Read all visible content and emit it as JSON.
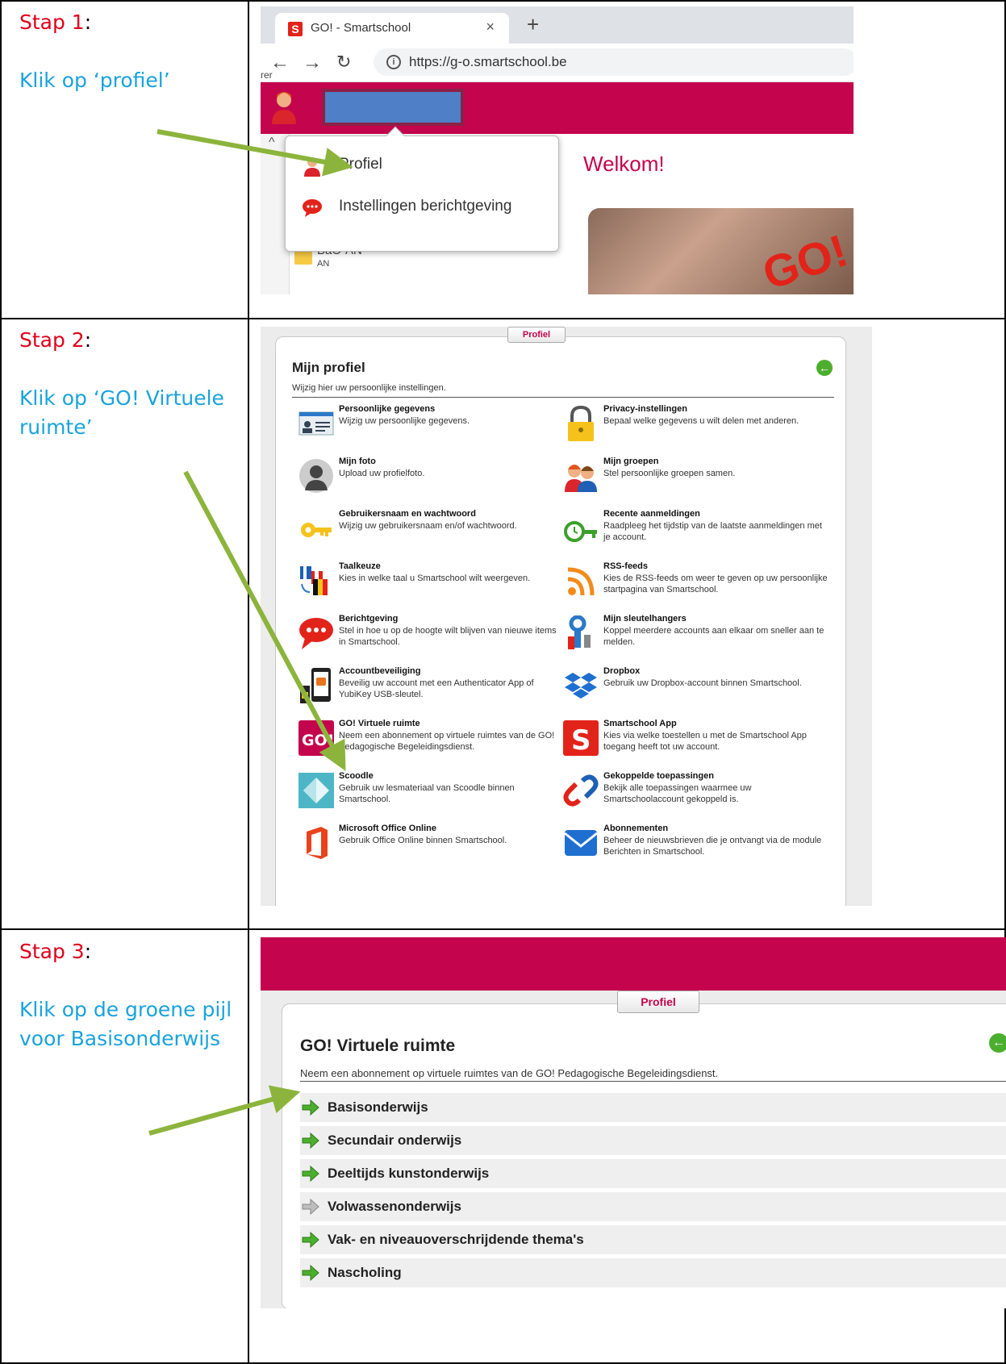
{
  "rows": [
    {
      "stap": "Stap 1",
      "colon": ":",
      "instruction": "Klik op ‘profiel’"
    },
    {
      "stap": "Stap 2",
      "colon": ":",
      "instruction": "Klik op ‘GO! Virtuele ruimte’"
    },
    {
      "stap": "Stap 3",
      "colon": ":",
      "instruction": "Klik op de groene pijl voor Basisonderwijs"
    }
  ],
  "step1": {
    "tab_title": "GO! - Smartschool",
    "tab_close": "×",
    "new_tab": "+",
    "url": "https://g-o.smartschool.be",
    "welcome": "Welkom!",
    "popup": [
      {
        "label": "Profiel",
        "icon": "user-icon"
      },
      {
        "label": "Instellingen berichtgeving",
        "icon": "chat-bubble-icon"
      }
    ],
    "sidebar_item": "BaO-AN",
    "sidebar_item_sub": "AN",
    "side_fragment": "rer",
    "logo_text": "GO!"
  },
  "step2": {
    "tab": "Profiel",
    "title": "Mijn profiel",
    "subtitle": "Wijzig hier uw persoonlijke instellingen.",
    "items_left": [
      {
        "title": "Persoonlijke gegevens",
        "desc": "Wijzig uw persoonlijke gegevens.",
        "icon": "id-card-icon"
      },
      {
        "title": "Mijn foto",
        "desc": "Upload uw profielfoto.",
        "icon": "avatar-icon"
      },
      {
        "title": "Gebruikersnaam en wachtwoord",
        "desc": "Wijzig uw gebruikersnaam en/of wachtwoord.",
        "icon": "key-icon"
      },
      {
        "title": "Taalkeuze",
        "desc": "Kies in welke taal u Smartschool wilt weergeven.",
        "icon": "flags-icon"
      },
      {
        "title": "Berichtgeving",
        "desc": "Stel in hoe u op de hoogte wilt blijven van nieuwe items in Smartschool.",
        "icon": "chat-bubble-icon"
      },
      {
        "title": "Accountbeveiliging",
        "desc": "Beveilig uw account met een Authenticator App of YubiKey USB-sleutel.",
        "icon": "phone-usb-icon"
      },
      {
        "title": "GO! Virtuele ruimte",
        "desc": "Neem een abonnement op virtuele ruimtes van de GO! Pedagogische Begeleidingsdienst.",
        "icon": "go-logo-icon"
      },
      {
        "title": "Scoodle",
        "desc": "Gebruik uw lesmateriaal van Scoodle binnen Smartschool.",
        "icon": "scoodle-icon"
      },
      {
        "title": "Microsoft Office Online",
        "desc": "Gebruik Office Online binnen Smartschool.",
        "icon": "office-icon"
      }
    ],
    "items_right": [
      {
        "title": "Privacy-instellingen",
        "desc": "Bepaal welke gegevens u wilt delen met anderen.",
        "icon": "padlock-icon"
      },
      {
        "title": "Mijn groepen",
        "desc": "Stel persoonlijke groepen samen.",
        "icon": "group-icon"
      },
      {
        "title": "Recente aanmeldingen",
        "desc": "Raadpleeg het tijdstip van de laatste aanmeldingen met je account.",
        "icon": "clock-key-icon"
      },
      {
        "title": "RSS-feeds",
        "desc": "Kies de RSS-feeds om weer te geven op uw persoonlijke startpagina van Smartschool.",
        "icon": "rss-icon"
      },
      {
        "title": "Mijn sleutelhangers",
        "desc": "Koppel meerdere accounts aan elkaar om sneller aan te melden.",
        "icon": "keychain-icon"
      },
      {
        "title": "Dropbox",
        "desc": "Gebruik uw Dropbox-account binnen Smartschool.",
        "icon": "dropbox-icon"
      },
      {
        "title": "Smartschool App",
        "desc": "Kies via welke toestellen u met de Smartschool App toegang heeft tot uw account.",
        "icon": "smartschool-s-icon"
      },
      {
        "title": "Gekoppelde toepassingen",
        "desc": "Bekijk alle toepassingen waarmee uw Smartschoolaccount gekoppeld is.",
        "icon": "link-icon"
      },
      {
        "title": "Abonnementen",
        "desc": "Beheer de nieuwsbrieven die je ontvangt via de module Berichten in Smartschool.",
        "icon": "envelope-icon"
      }
    ]
  },
  "step3": {
    "tab": "Profiel",
    "title": "GO! Virtuele ruimte",
    "subtitle": "Neem een abonnement op virtuele ruimtes van de GO! Pedagogische Begeleidingsdienst.",
    "rows": [
      {
        "label": "Basisonderwijs",
        "enabled": true
      },
      {
        "label": "Secundair onderwijs",
        "enabled": true
      },
      {
        "label": "Deeltijds kunstonderwijs",
        "enabled": true
      },
      {
        "label": "Volwassenonderwijs",
        "enabled": false
      },
      {
        "label": "Vak- en niveauoverschrijdende thema's",
        "enabled": true
      },
      {
        "label": "Nascholing",
        "enabled": true
      }
    ]
  },
  "colors": {
    "stap": "#e0001b",
    "instruction": "#1aa3dc",
    "smartschool_magenta": "#c4044d",
    "arrow_green": "#8cb43c",
    "go_green": "#4cae2e"
  }
}
